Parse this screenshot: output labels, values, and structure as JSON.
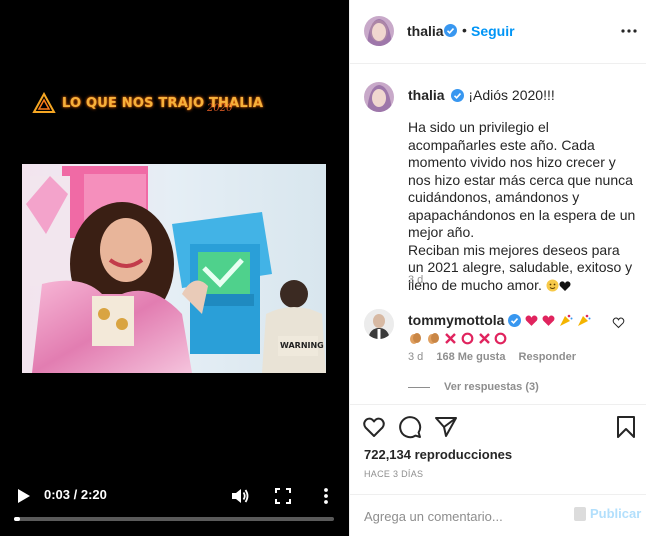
{
  "video": {
    "overlay_title": "LO QUE NOS TRAJO THALIA",
    "overlay_sub": "2020",
    "time_display": "0:03 / 2:20",
    "progress_fraction": 0.018
  },
  "header": {
    "username": "thalia",
    "separator": "•",
    "follow_label": "Seguir"
  },
  "caption": {
    "username": "thalia",
    "headline": "¡Adiós 2020!!!",
    "body": "Ha sido un privilegio el acompañarles este año. Cada momento vivido nos hizo crecer y nos hizo estar más cerca que nunca cuidándonos, amándonos y apapachándonos en la espera de un mejor año.\nReciban mis mejores deseos para un 2021 alegre, saludable, exitoso y lleno de mucho amor.",
    "time": "3 d"
  },
  "comment": {
    "username": "tommymottola",
    "time": "3 d",
    "likes": "168 Me gusta",
    "reply_label": "Responder",
    "view_replies": "Ver respuestas (3)"
  },
  "stats": {
    "plays": "722,134 reproducciones",
    "ago": "HACE 3 DÍAS"
  },
  "composer": {
    "placeholder": "Agrega un comentario...",
    "publish_label": "Publicar"
  },
  "colors": {
    "link_blue": "#0095f6",
    "publish_disabled": "#b2dffc",
    "verified": "#3897f0",
    "heart_red": "#ed4956"
  },
  "icons": [
    "play-icon",
    "volume-icon",
    "fullscreen-icon",
    "more-vertical-icon",
    "verified-icon",
    "more-horizontal-icon",
    "heart-icon",
    "comment-icon",
    "share-icon",
    "bookmark-icon"
  ]
}
